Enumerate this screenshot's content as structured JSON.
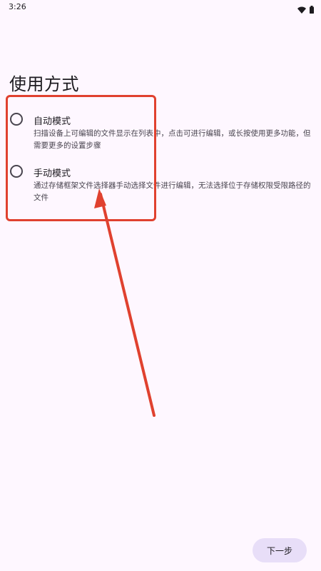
{
  "status_bar": {
    "time": "3:26",
    "icons": [
      "wifi-icon",
      "battery-icon"
    ]
  },
  "page": {
    "title": "使用方式"
  },
  "options": [
    {
      "title": "自动模式",
      "description": "扫描设备上可编辑的文件显示在列表中，点击可进行编辑，或长按使用更多功能，但需要更多的设置步骤",
      "selected": false
    },
    {
      "title": "手动模式",
      "description": "通过存储框架文件选择器手动选择文件进行编辑，无法选择位于存储权限受限路径的文件",
      "selected": false
    }
  ],
  "footer": {
    "next_label": "下一步"
  },
  "colors": {
    "background": "#fef7ff",
    "annotation": "#e0412f",
    "button_bg": "#e8def8"
  }
}
